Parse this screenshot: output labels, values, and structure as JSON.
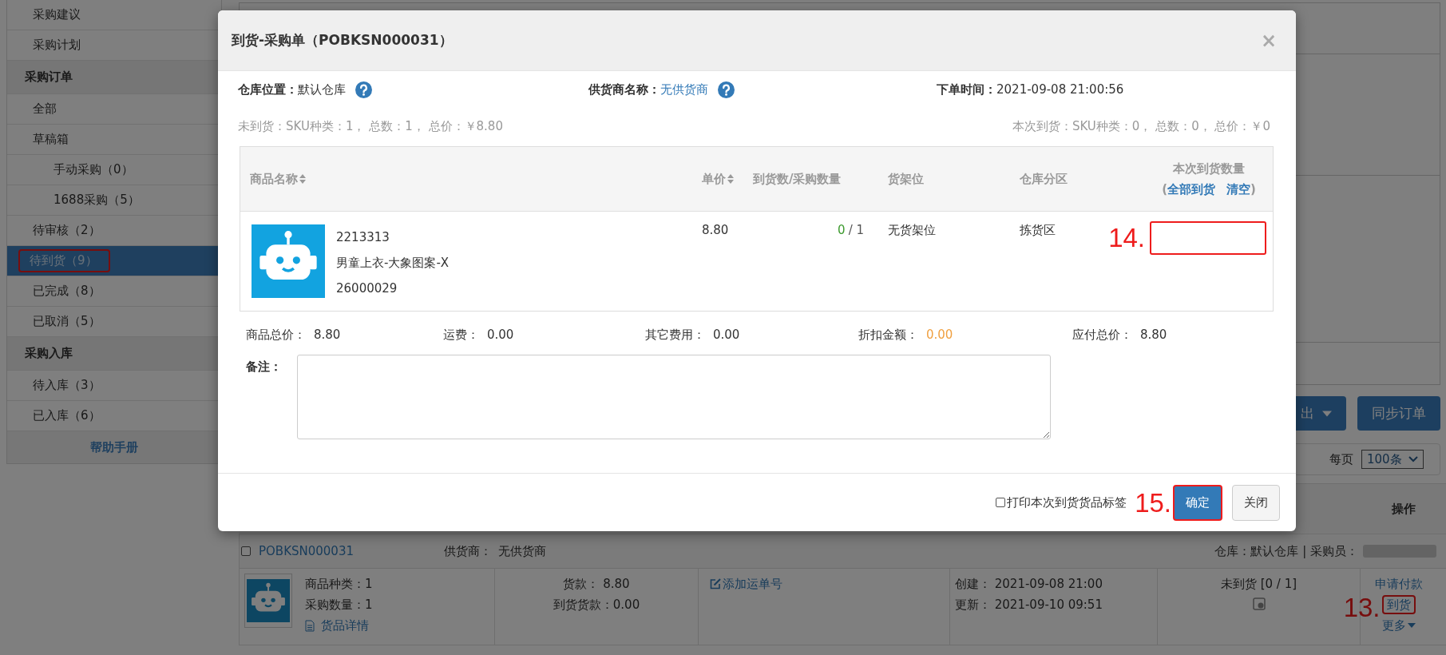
{
  "sidebar": {
    "items": [
      {
        "label": "采购建议",
        "kind": "item",
        "selected": false,
        "outlined": false
      },
      {
        "label": "采购计划",
        "kind": "item",
        "selected": false,
        "outlined": false
      },
      {
        "label": "采购订单",
        "kind": "header"
      },
      {
        "label": "全部",
        "kind": "item",
        "selected": false,
        "outlined": false
      },
      {
        "label": "草稿箱",
        "kind": "item",
        "selected": false,
        "outlined": false
      },
      {
        "label": "手动采购（0）",
        "kind": "subitem",
        "selected": false,
        "outlined": false
      },
      {
        "label": "1688采购（5）",
        "kind": "subitem",
        "selected": false,
        "outlined": false
      },
      {
        "label": "待审核（2）",
        "kind": "item",
        "selected": false,
        "outlined": false
      },
      {
        "label": "待到货（9）",
        "kind": "item",
        "selected": true,
        "outlined": true
      },
      {
        "label": "已完成（8）",
        "kind": "item",
        "selected": false,
        "outlined": false
      },
      {
        "label": "已取消（5）",
        "kind": "item",
        "selected": false,
        "outlined": false
      },
      {
        "label": "采购入库",
        "kind": "header"
      },
      {
        "label": "待入库（3）",
        "kind": "item",
        "selected": false,
        "outlined": false
      },
      {
        "label": "已入库（6）",
        "kind": "item",
        "selected": false,
        "outlined": false
      }
    ],
    "help_link": "帮助手册"
  },
  "toolbar": {
    "buttons": [
      {
        "label": "出",
        "kind": "dropdown"
      },
      {
        "label": "同步订单",
        "kind": "plain"
      }
    ]
  },
  "pagination": {
    "label": "每页",
    "page_size": "100条"
  },
  "table": {
    "columns": [
      {
        "label": "操作"
      }
    ],
    "order": {
      "checked": false,
      "order_no": "POBKSN000031",
      "supplier_label": "供货商：",
      "supplier": "无供货商",
      "warehouse_info": "仓库：默认仓库 | 采购员：",
      "item_types": "商品种类：1",
      "quantity": "采购数量：1",
      "details_link": "货品详情",
      "payment": "货款： 8.80",
      "arrival_payment": "到货货款：0.00",
      "add_tracking": "添加运单号",
      "created": "创建： 2021-09-08 21:00",
      "updated": "更新： 2021-09-10 09:51",
      "status": "未到货 [0 / 1]",
      "actions": [
        {
          "label": "申请付款",
          "kind": "link",
          "outlined": false
        },
        {
          "label": "到货",
          "kind": "link",
          "outlined": true,
          "marker": "13."
        },
        {
          "label": "更多",
          "kind": "dropdown",
          "outlined": false
        }
      ]
    }
  },
  "dialog": {
    "title": "到货-采购单（POBKSN000031）",
    "close": "×",
    "info": [
      {
        "label": "仓库位置：",
        "value": "默认仓库",
        "link": false,
        "help": true
      },
      {
        "label": "供货商名称：",
        "value": "无供货商",
        "link": true,
        "help": true
      },
      {
        "label": "下单时间：",
        "value": "2021-09-08 21:00:56",
        "link": false,
        "help": false
      }
    ],
    "summary_left": "未到货：SKU种类：1， 总数：1， 总价：￥8.80",
    "summary_right": "本次到货：SKU种类：0， 总数：0， 总价：￥0",
    "columns": [
      {
        "label": "商品名称",
        "sortable": true
      },
      {
        "label": "单价",
        "sortable": true
      },
      {
        "label": "到货数/采购数量",
        "sortable": false
      },
      {
        "label": "货架位",
        "sortable": false
      },
      {
        "label": "仓库分区",
        "sortable": false
      },
      {
        "label": "本次到货数量",
        "sortable": false
      }
    ],
    "bulk_open": "(",
    "bulk_links": [
      "全部到货",
      "清空"
    ],
    "bulk_close": ")",
    "rows": [
      {
        "sku": "2213313",
        "name": "男童上衣-大象图案-X",
        "code": "26000029",
        "price": "8.80",
        "arrived": "0",
        "ordered": "/ 1",
        "shelf": "无货架位",
        "zone": "拣货区",
        "marker": "14.",
        "outlined": true
      }
    ],
    "totals": [
      {
        "label": "商品总价：",
        "value": "8.80",
        "highlight": false
      },
      {
        "label": "运费：",
        "value": "0.00",
        "highlight": false
      },
      {
        "label": "其它费用：",
        "value": "0.00",
        "highlight": false
      },
      {
        "label": "折扣金额：",
        "value": "0.00",
        "highlight": true
      },
      {
        "label": "应付总价：",
        "value": "8.80",
        "highlight": false
      }
    ],
    "remark_label": "备注：",
    "print_option": {
      "label": "打印本次到货货品标签",
      "checked": false
    },
    "buttons": [
      {
        "label": "确定",
        "kind": "primary",
        "outlined": true,
        "marker": "15."
      },
      {
        "label": "关闭",
        "kind": "default",
        "outlined": false
      }
    ]
  }
}
